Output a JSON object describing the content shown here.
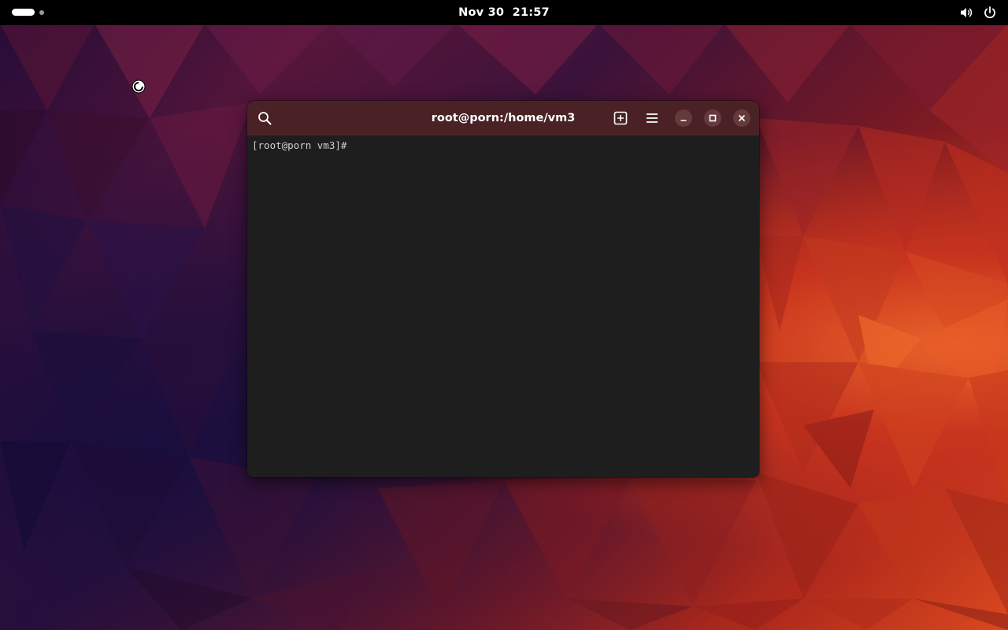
{
  "topbar": {
    "date": "Nov 30",
    "time": "21:57",
    "icons": {
      "workspace_active": "workspace-pill-icon",
      "workspace_inactive": "workspace-dot-icon",
      "volume": "volume-icon",
      "power": "power-icon"
    }
  },
  "terminal_window": {
    "title": "root@porn:/home/vm3",
    "buttons": {
      "search": "search-icon",
      "new_tab": "new-tab-icon",
      "menu": "hamburger-menu-icon",
      "minimize": "minimize-icon",
      "maximize": "maximize-icon",
      "close": "close-icon"
    },
    "prompt": "[root@porn vm3]#"
  },
  "colors": {
    "topbar_bg": "#000000",
    "headerbar_bg": "#4a2226",
    "terminal_bg": "#1e1e1e",
    "terminal_fg": "#d0d0d0"
  }
}
